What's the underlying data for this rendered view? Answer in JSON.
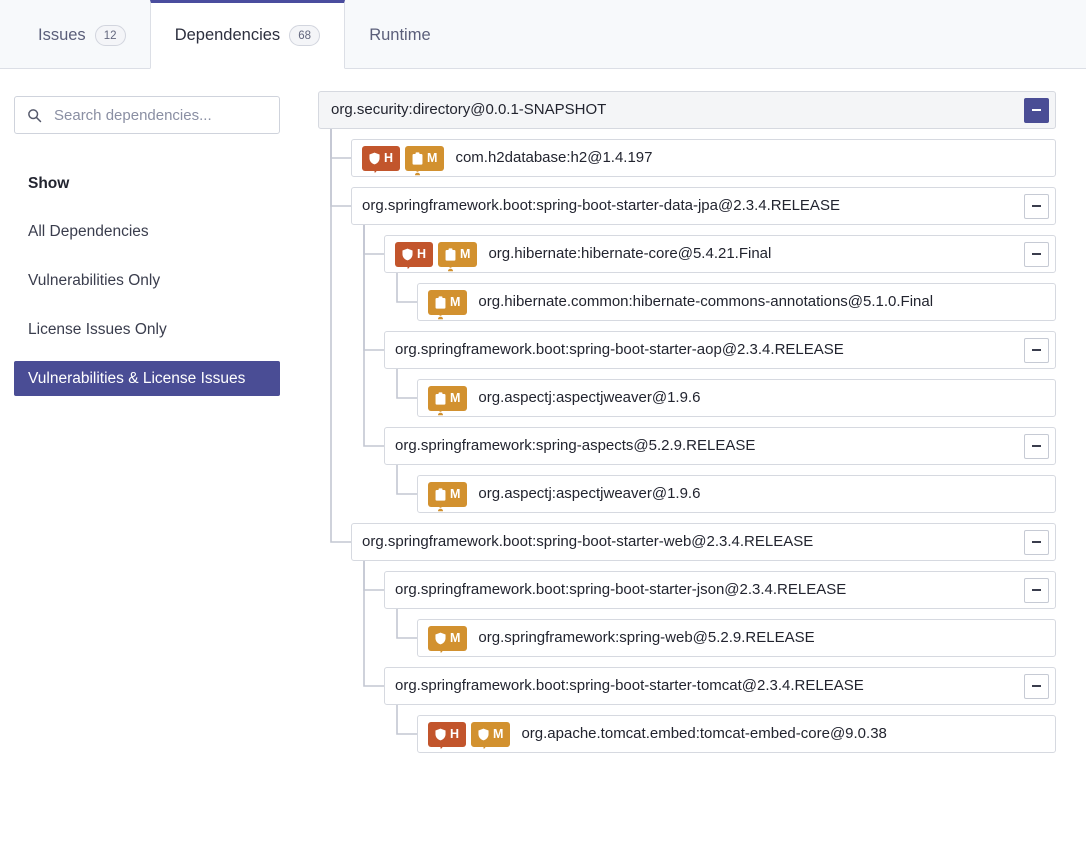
{
  "tabs": [
    {
      "label": "Issues",
      "badge": "12",
      "active": false
    },
    {
      "label": "Dependencies",
      "badge": "68",
      "active": true
    },
    {
      "label": "Runtime",
      "badge": "",
      "active": false
    }
  ],
  "sidebar": {
    "search": {
      "value": "",
      "placeholder": "Search dependencies...",
      "icon": "search-icon"
    },
    "show_label": "Show",
    "filters": [
      {
        "label": "All Dependencies",
        "selected": false
      },
      {
        "label": "Vulnerabilities Only",
        "selected": false
      },
      {
        "label": "License Issues Only",
        "selected": false
      },
      {
        "label": "Vulnerabilities & License Issues",
        "selected": true
      }
    ]
  },
  "colors": {
    "accent": "#4a4d95",
    "severity_high": "#c2552c",
    "severity_medium": "#d2912f",
    "tabstrip_bg": "#f7f9fb",
    "root_row_bg": "#f4f5f7",
    "border": "#d6d9e0"
  },
  "tree": {
    "collapse_glyph": "-",
    "nodes": [
      {
        "depth": 0,
        "label": "org.security:directory@0.0.1-SNAPSHOT",
        "root": true,
        "toggle": true,
        "badges": []
      },
      {
        "depth": 1,
        "label": "com.h2database:h2@1.4.197",
        "toggle": false,
        "badges": [
          {
            "icon": "shield-icon",
            "severity": "H",
            "type": "vulnerability"
          },
          {
            "icon": "license-icon",
            "severity": "M",
            "type": "license"
          }
        ]
      },
      {
        "depth": 1,
        "label": "org.springframework.boot:spring-boot-starter-data-jpa@2.3.4.RELEASE",
        "toggle": true,
        "badges": []
      },
      {
        "depth": 2,
        "label": "org.hibernate:hibernate-core@5.4.21.Final",
        "toggle": true,
        "badges": [
          {
            "icon": "shield-icon",
            "severity": "H",
            "type": "vulnerability"
          },
          {
            "icon": "license-icon",
            "severity": "M",
            "type": "license"
          }
        ]
      },
      {
        "depth": 3,
        "label": "org.hibernate.common:hibernate-commons-annotations@5.1.0.Final",
        "toggle": false,
        "badges": [
          {
            "icon": "license-icon",
            "severity": "M",
            "type": "license"
          }
        ]
      },
      {
        "depth": 2,
        "label": "org.springframework.boot:spring-boot-starter-aop@2.3.4.RELEASE",
        "toggle": true,
        "badges": []
      },
      {
        "depth": 3,
        "label": "org.aspectj:aspectjweaver@1.9.6",
        "toggle": false,
        "badges": [
          {
            "icon": "license-icon",
            "severity": "M",
            "type": "license"
          }
        ]
      },
      {
        "depth": 2,
        "label": "org.springframework:spring-aspects@5.2.9.RELEASE",
        "toggle": true,
        "badges": []
      },
      {
        "depth": 3,
        "label": "org.aspectj:aspectjweaver@1.9.6",
        "toggle": false,
        "badges": [
          {
            "icon": "license-icon",
            "severity": "M",
            "type": "license"
          }
        ]
      },
      {
        "depth": 1,
        "label": "org.springframework.boot:spring-boot-starter-web@2.3.4.RELEASE",
        "toggle": true,
        "badges": []
      },
      {
        "depth": 2,
        "label": "org.springframework.boot:spring-boot-starter-json@2.3.4.RELEASE",
        "toggle": true,
        "badges": []
      },
      {
        "depth": 3,
        "label": "org.springframework:spring-web@5.2.9.RELEASE",
        "toggle": false,
        "badges": [
          {
            "icon": "shield-icon",
            "severity": "M",
            "type": "vulnerability"
          }
        ]
      },
      {
        "depth": 2,
        "label": "org.springframework.boot:spring-boot-starter-tomcat@2.3.4.RELEASE",
        "toggle": true,
        "badges": []
      },
      {
        "depth": 3,
        "label": "org.apache.tomcat.embed:tomcat-embed-core@9.0.38",
        "toggle": false,
        "badges": [
          {
            "icon": "shield-icon",
            "severity": "H",
            "type": "vulnerability"
          },
          {
            "icon": "shield-icon",
            "severity": "M",
            "type": "vulnerability"
          }
        ]
      }
    ]
  }
}
